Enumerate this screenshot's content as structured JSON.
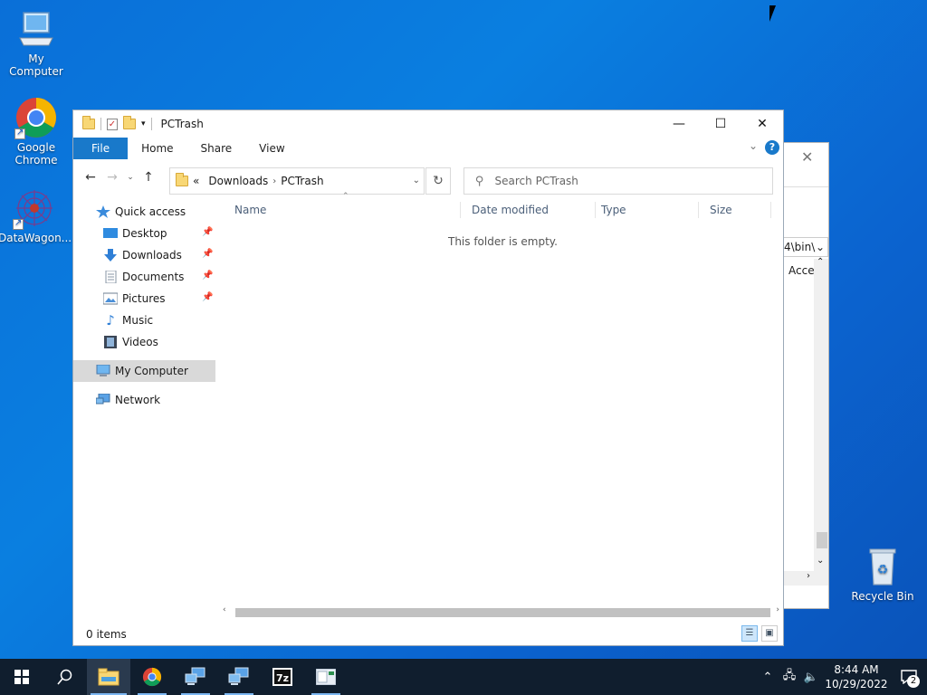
{
  "desktop": {
    "icons": [
      {
        "label": "My Computer"
      },
      {
        "label": "Google Chrome"
      },
      {
        "label": "DataWagon..."
      },
      {
        "label": "Recycle Bin"
      }
    ]
  },
  "background_window": {
    "path_fragment": "4\\bin\\",
    "column_fragment": "Acce"
  },
  "explorer": {
    "title": "PCTrash",
    "ribbon_tabs": [
      "File",
      "Home",
      "Share",
      "View"
    ],
    "help_label": "?",
    "address": {
      "prefix": "«",
      "crumbs": [
        "Downloads",
        "PCTrash"
      ]
    },
    "search": {
      "placeholder": "Search PCTrash"
    },
    "columns": [
      "Name",
      "Date modified",
      "Type",
      "Size"
    ],
    "empty_message": "This folder is empty.",
    "status": "0 items",
    "nav": {
      "quick_access": "Quick access",
      "pinned": [
        {
          "label": "Desktop",
          "icon": "desktop-icon",
          "pinned": true
        },
        {
          "label": "Downloads",
          "icon": "downloads-icon",
          "pinned": true
        },
        {
          "label": "Documents",
          "icon": "documents-icon",
          "pinned": true
        },
        {
          "label": "Pictures",
          "icon": "pictures-icon",
          "pinned": true
        },
        {
          "label": "Music",
          "icon": "music-icon",
          "pinned": false
        },
        {
          "label": "Videos",
          "icon": "videos-icon",
          "pinned": false
        }
      ],
      "my_computer": "My Computer",
      "network": "Network"
    }
  },
  "taskbar": {
    "clock_time": "8:44 AM",
    "clock_date": "10/29/2022",
    "notification_count": "2",
    "apps": [
      "start",
      "search",
      "file-explorer",
      "chrome",
      "network-app-1",
      "network-app-2",
      "7zip",
      "app-window"
    ]
  },
  "colors": {
    "accent": "#1979ca",
    "taskbar": "#101e2e",
    "desktop": "#0a6fd8"
  }
}
